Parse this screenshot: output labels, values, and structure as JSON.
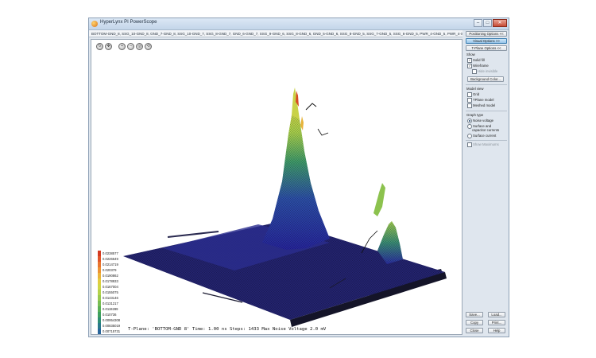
{
  "window": {
    "title": "HyperLynx PI PowerScope",
    "min": "–",
    "max": "□",
    "close": "✕"
  },
  "tabs_text": "BOTTOM-GND_8, SSG_10-GND_8, GND_7-GND_8, SSG_10-GND_7, SSG_8-GND_7, GND_6-GND_7, SSG_9-GND_6, SSG_8-GND_6, GND_5-GND_6, SSG_8-GND_5, SSG_7-GND_5, SSG_6-GND_5, PWR_4-GND_5, PWR_4-SSG_7, SSG_",
  "toolbar": [
    "rotate-icon",
    "pan-icon",
    "blank",
    "zoom-in-icon",
    "zoom-out-icon",
    "fit-icon",
    "reset-icon"
  ],
  "legend": [
    {
      "label": "0.0238577",
      "color": "#d43b22"
    },
    {
      "label": "0.0226649",
      "color": "#e0562a"
    },
    {
      "label": "0.0214719",
      "color": "#e8752f"
    },
    {
      "label": "0.020379",
      "color": "#ec9334"
    },
    {
      "label": "0.0190862",
      "color": "#eab33a"
    },
    {
      "label": "0.0178933",
      "color": "#e2cc3f"
    },
    {
      "label": "0.0167004",
      "color": "#cfd646"
    },
    {
      "label": "0.0155075",
      "color": "#b5d24b"
    },
    {
      "label": "0.0143146",
      "color": "#98c950"
    },
    {
      "label": "0.0131217",
      "color": "#78bd53"
    },
    {
      "label": "0.0119289",
      "color": "#59b057"
    },
    {
      "label": "0.010736",
      "color": "#3fa05f"
    },
    {
      "label": "0.00954308",
      "color": "#2f8e74"
    },
    {
      "label": "0.00835019",
      "color": "#2a7a8a"
    },
    {
      "label": "0.00715731",
      "color": "#2a669c"
    },
    {
      "label": "0.00596442",
      "color": "#2b54a8"
    },
    {
      "label": "0.00477154",
      "color": "#2c44ad"
    },
    {
      "label": "0.00357866",
      "color": "#2c37a8"
    },
    {
      "label": "0.00238577",
      "color": "#2a2c9c"
    },
    {
      "label": "0.00119288",
      "color": "#25248c"
    },
    {
      "label": "0 V",
      "color": "#1f1d78"
    }
  ],
  "status": "T-Plane: 'BOTTOM-GND 8' Time: 1.00 ns Steps: 1433  Max Noise Voltage 2.0 mV",
  "panel": {
    "positioning": "Positioning Options <<",
    "visual": "Visual Options >>",
    "tplane": "T-Plane Options <<",
    "show_label": "Show",
    "solid_fill": "Solid fill",
    "wireframe": "Wireframe",
    "hide_invisible": "Hide invisible",
    "background_color": "Background Color...",
    "model_view_label": "Model view",
    "grid": "Grid",
    "tplane_model": "TPlane model",
    "meshed_model": "Meshed model",
    "graph_type_label": "Graph type",
    "noise_voltage": "Noise voltage",
    "surface_cap_1": "Surface and",
    "surface_cap_2": "capacitor currents",
    "surface_current": "Surface current",
    "show_maximums": "Show Maximums",
    "save": "Save...",
    "load": "Load...",
    "copy": "Copy",
    "print": "Print...",
    "close": "Close",
    "help": "Help"
  }
}
